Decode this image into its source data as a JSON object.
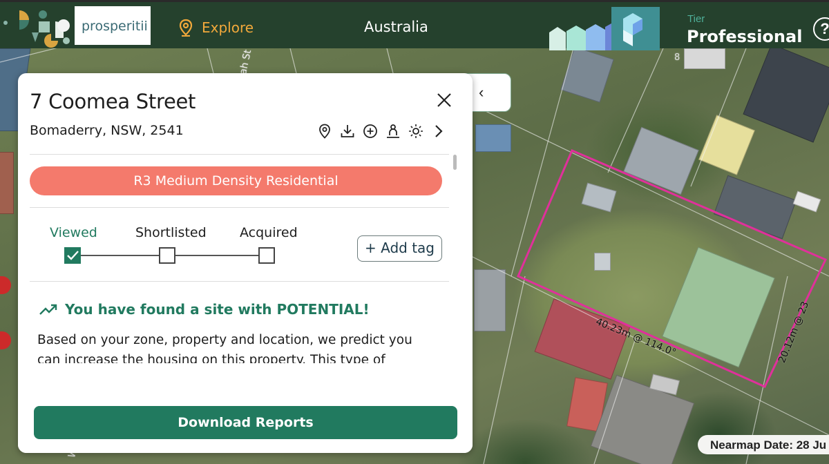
{
  "header": {
    "logo_text": "prosperitii",
    "explore_label": "Explore",
    "country": "Australia",
    "tier_caption": "Tier",
    "tier_value": "Professional",
    "help_glyph": "?"
  },
  "map": {
    "lot_label_front": "40.23m @ 114.0°",
    "lot_label_side": "20.12m @ 23",
    "street_fragment": "ah St",
    "street_fragment_2": "W",
    "house_number": "8",
    "nearmap_date": "Nearmap Date: 28 Ju"
  },
  "panel": {
    "collapse_glyph": "‹",
    "address": "7 Coomea Street",
    "suburb": "Bomaderry, NSW, 2541",
    "tools": [
      "location-pin-icon",
      "download-icon",
      "plus-circle-icon",
      "person-icon",
      "sun-icon",
      "chevron-right-icon"
    ],
    "zone": "R3 Medium Density Residential",
    "stages": [
      {
        "label": "Viewed",
        "checked": true
      },
      {
        "label": "Shortlisted",
        "checked": false
      },
      {
        "label": "Acquired",
        "checked": false
      }
    ],
    "add_tag": "+ Add tag",
    "potential": "You have found a site with POTENTIAL!",
    "predict_text": "Based on your zone, property and location, we predict you can increase the housing on this property. This type of development",
    "download_button": "Download Reports"
  },
  "colors": {
    "topbar": "#25412d",
    "brand_green": "#217a5f",
    "explore_orange": "#f2a93b",
    "zone_salmon": "#f47a6c",
    "lot_outline": "#e0309b"
  }
}
